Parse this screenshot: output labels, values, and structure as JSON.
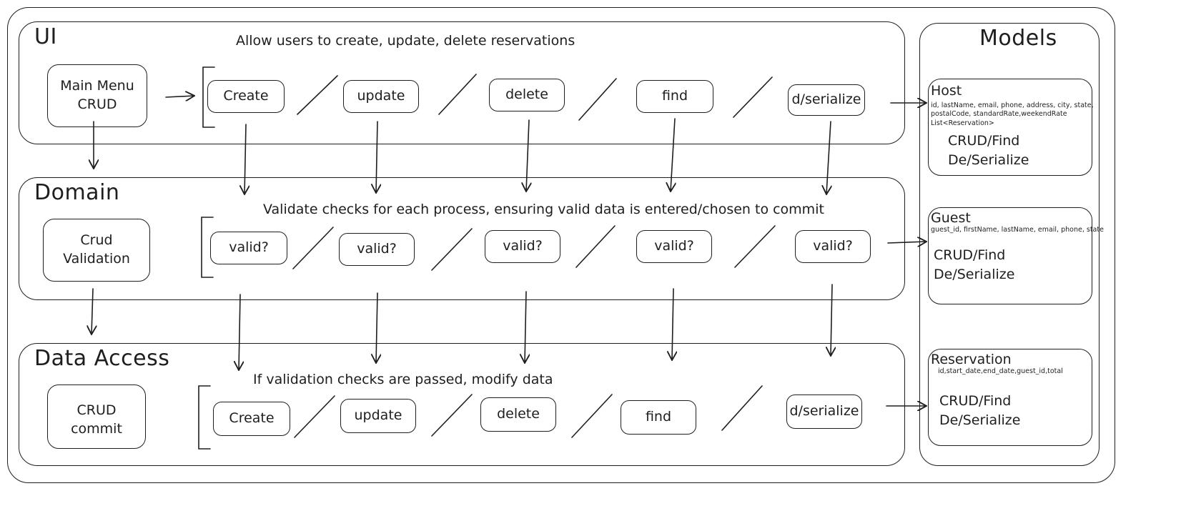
{
  "layers": {
    "ui": {
      "title": "UI",
      "description": "Allow users to create, update, delete reservations",
      "main": [
        "Main Menu",
        "CRUD"
      ],
      "ops": [
        "Create",
        "update",
        "delete",
        "find",
        "d/serialize"
      ]
    },
    "domain": {
      "title": "Domain",
      "description": "Validate checks for each process, ensuring valid data is entered/chosen to commit",
      "main": [
        "Crud",
        "Validation"
      ],
      "ops": [
        "valid?",
        "valid?",
        "valid?",
        "valid?",
        "valid?"
      ]
    },
    "data_access": {
      "title": "Data Access",
      "description": "If validation checks are passed, modify data",
      "main": [
        "CRUD",
        "commit"
      ],
      "ops": [
        "Create",
        "update",
        "delete",
        "find",
        "d/serialize"
      ]
    }
  },
  "models": {
    "title": "Models",
    "host": {
      "name": "Host",
      "attrs": [
        "id, lastName, email, phone, address, city, state,",
        "postalCode, standardRate,weekendRate",
        "List<Reservation>"
      ],
      "ops": [
        "CRUD/Find",
        "De/Serialize"
      ]
    },
    "guest": {
      "name": "Guest",
      "attrs": [
        "guest_id, firstName, lastName, email, phone, state"
      ],
      "ops": [
        "CRUD/Find",
        "De/Serialize"
      ]
    },
    "reservation": {
      "name": "Reservation",
      "attrs": [
        "id,start_date,end_date,guest_id,total"
      ],
      "ops": [
        "CRUD/Find",
        "De/Serialize"
      ]
    }
  }
}
